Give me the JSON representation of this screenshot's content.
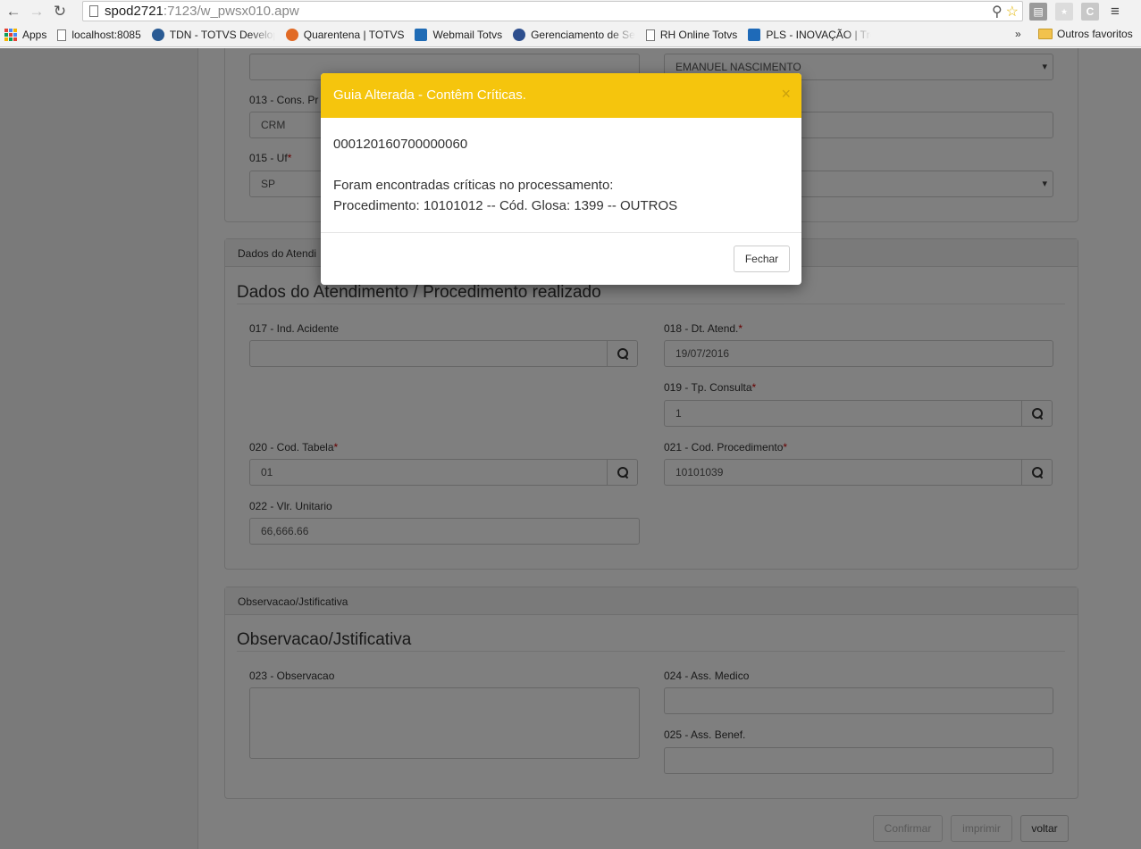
{
  "browser": {
    "url_host": "spod2721",
    "url_rest": ":7123/w_pwsx010.apw",
    "ext3_letter": "C",
    "bookmarks": [
      {
        "label": "Apps"
      },
      {
        "label": "localhost:8085"
      },
      {
        "label": "TDN - TOTVS Develop"
      },
      {
        "label": "Quarentena | TOTVS"
      },
      {
        "label": "Webmail Totvs"
      },
      {
        "label": "Gerenciamento de Se"
      },
      {
        "label": "RH Online Totvs"
      },
      {
        "label": "PLS - INOVAÇÃO | Tre"
      }
    ],
    "more_bookmarks": "»",
    "other_favorites": "Outros favoritos"
  },
  "form": {
    "top_left_field": "",
    "top_right_select": "EMANUEL NASCIMENTO",
    "f013_label": "013 - Cons. Pr",
    "f013_value": "CRM",
    "f014_value": "",
    "f015_label": "015 - Uf",
    "f015_value": "SP",
    "f016_value": "",
    "attend_panel_head": "Dados do Atendi",
    "attend_title": "Dados do Atendimento / Procedimento realizado",
    "f017_label": "017 - Ind. Acidente",
    "f017_value": "",
    "f018_label": "018 - Dt. Atend.",
    "f018_value": "19/07/2016",
    "f019_label": "019 - Tp. Consulta",
    "f019_value": "1",
    "f020_label": "020 - Cod. Tabela",
    "f020_value": "01",
    "f021_label": "021 - Cod. Procedimento",
    "f021_value": "10101039",
    "f022_label": "022 - Vlr. Unitario",
    "f022_value": "66,666.66",
    "obs_panel_head": "Observacao/Jstificativa",
    "obs_title": "Observacao/Jstificativa",
    "f023_label": "023 - Observacao",
    "f024_label": "024 - Ass. Medico",
    "f024_value": "",
    "f025_label": "025 - Ass. Benef.",
    "f025_value": "",
    "required_mark": "*",
    "buttons": {
      "confirm": "Confirmar",
      "print": "imprimir",
      "back": "voltar"
    }
  },
  "modal": {
    "title": "Guia Alterada - Contêm Críticas.",
    "close_glyph": "×",
    "guide_number": "000120160700000060",
    "message_line1": "Foram encontradas críticas no processamento:",
    "message_line2": "Procedimento: 10101012 -- Cód. Glosa: 1399 -- OUTROS",
    "close_button": "Fechar"
  },
  "colors": {
    "modal_header": "#f5c50d",
    "overlay": "rgba(0,0,0,0.5)",
    "required": "#cc0000"
  }
}
